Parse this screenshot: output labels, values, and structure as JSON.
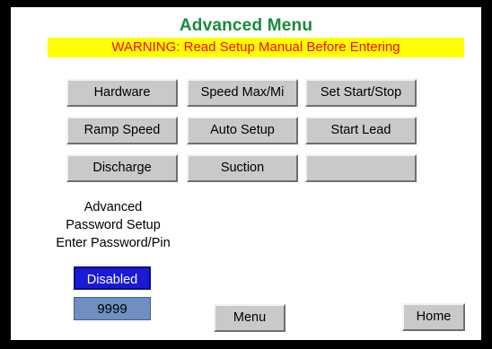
{
  "header": {
    "title": "Advanced Menu",
    "warning": "WARNING: Read Setup Manual Before Entering"
  },
  "buttons": {
    "hardware": "Hardware",
    "speed_max": "Speed Max/Mi",
    "set_start_stop": "Set Start/Stop",
    "ramp_speed": "Ramp Speed",
    "auto_setup": "Auto Setup",
    "start_lead": "Start Lead",
    "discharge": "Discharge",
    "suction": "Suction",
    "blank": ""
  },
  "password": {
    "line1": "Advanced",
    "line2": "Password Setup",
    "line3": "Enter Password/Pin",
    "status": "Disabled",
    "pin": "9999"
  },
  "nav": {
    "menu": "Menu",
    "home": "Home"
  },
  "colors": {
    "title": "#1a8a3a",
    "warning_bg": "#ffff00",
    "warning_text": "#ff0000",
    "button_face": "#c9c9c9",
    "status_bg": "#1a1ad6",
    "pin_bg": "#6f8fc0"
  }
}
